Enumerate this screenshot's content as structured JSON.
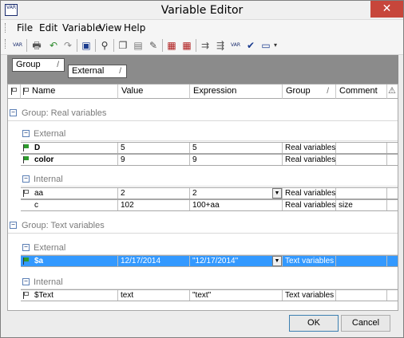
{
  "window": {
    "title": "Variable Editor",
    "icon": "VAR",
    "close_glyph": "✕"
  },
  "menu": {
    "items": [
      "File",
      "Edit",
      "Variable",
      "View",
      "Help"
    ]
  },
  "toolbar": {
    "icons": [
      "add-variable-icon",
      "print-icon",
      "undo-icon",
      "redo-icon",
      "properties-icon",
      "find-icon",
      "copy-icon",
      "paste-icon",
      "format-painter-icon",
      "export-icon",
      "import-icon",
      "indent-icon",
      "outdent-icon",
      "variable-icon",
      "check-variable-icon",
      "window-icon",
      "overflow-chevron-icon"
    ],
    "var_label": "VAR"
  },
  "grouping": {
    "chips": [
      {
        "label": "Group",
        "sort": "/"
      },
      {
        "label": "External",
        "sort": "/"
      }
    ]
  },
  "columns": {
    "name": "Name",
    "value": "Value",
    "expression": "Expression",
    "group": "Group",
    "group_sort": "/",
    "comment": "Comment",
    "warning_glyph": "⚠"
  },
  "groups": [
    {
      "label": "Group: Real variables",
      "subgroups": [
        {
          "label": "External",
          "rows": [
            {
              "name": "D",
              "value": "5",
              "expression": "5",
              "group": "Real variables",
              "comment": "",
              "bold": true,
              "flag": "green"
            },
            {
              "name": "color",
              "value": "9",
              "expression": "9",
              "group": "Real variables",
              "comment": "",
              "bold": true,
              "flag": "green"
            }
          ]
        },
        {
          "label": "Internal",
          "rows": [
            {
              "name": "aa",
              "value": "2",
              "expression": "2",
              "group": "Real variables",
              "comment": "",
              "bold": false,
              "flag": "white",
              "dropdown": true
            },
            {
              "name": "c",
              "value": "102",
              "expression": "100+aa",
              "group": "Real variables",
              "comment": "size",
              "bold": false,
              "flag": "none"
            }
          ]
        }
      ]
    },
    {
      "label": "Group: Text variables",
      "subgroups": [
        {
          "label": "External",
          "rows": [
            {
              "name": "$a",
              "value": "12/17/2014",
              "expression": "\"12/17/2014\"",
              "group": "Text variables",
              "comment": "",
              "bold": true,
              "flag": "green",
              "dropdown": true,
              "selected": true
            }
          ]
        },
        {
          "label": "Internal",
          "rows": [
            {
              "name": "$Text",
              "value": "text",
              "expression": "\"text\"",
              "group": "Text variables",
              "comment": "",
              "bold": false,
              "flag": "white"
            }
          ]
        }
      ]
    }
  ],
  "buttons": {
    "ok": "OK",
    "cancel": "Cancel"
  },
  "colors": {
    "selection": "#3399ff",
    "flag_green": "#2e9b2e",
    "close_red": "#c7463b",
    "group_area": "#8b8b8b"
  }
}
